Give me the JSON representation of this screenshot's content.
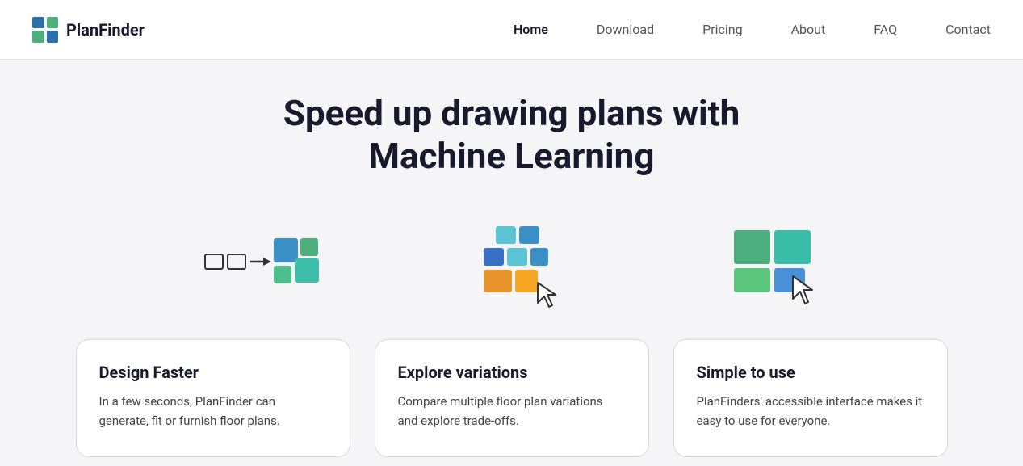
{
  "nav": {
    "logo_text": "PlanFinder",
    "links": [
      {
        "label": "Home",
        "active": true
      },
      {
        "label": "Download",
        "active": false
      },
      {
        "label": "Pricing",
        "active": false
      },
      {
        "label": "About",
        "active": false
      },
      {
        "label": "FAQ",
        "active": false
      },
      {
        "label": "Contact",
        "active": false
      }
    ]
  },
  "hero": {
    "title_line1": "Speed up drawing plans with",
    "title_line2": "Machine Learning"
  },
  "cards": [
    {
      "title": "Design Faster",
      "body": "In a few seconds, PlanFinder can generate, fit or furnish floor plans."
    },
    {
      "title": "Explore variations",
      "body": "Compare multiple floor plan variations and explore trade-offs."
    },
    {
      "title": "Simple to use",
      "body": "PlanFinders' accessible interface makes it easy to use for everyone."
    }
  ]
}
